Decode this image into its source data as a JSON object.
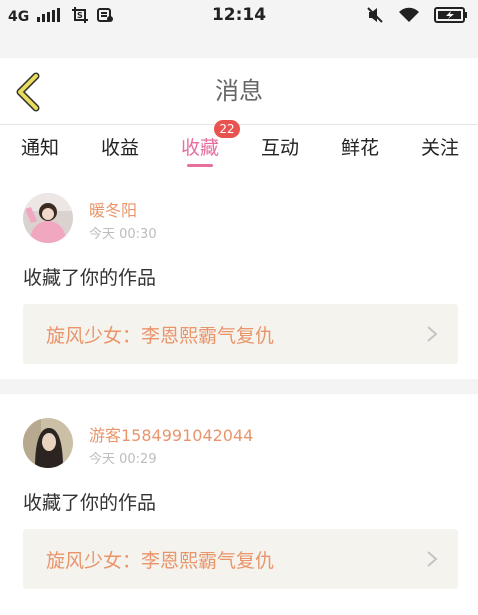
{
  "status_bar": {
    "network": "4G",
    "time": "12:14"
  },
  "header": {
    "title": "消息"
  },
  "tabs": [
    {
      "label": "通知"
    },
    {
      "label": "收益"
    },
    {
      "label": "收藏",
      "active": true,
      "badge": "22"
    },
    {
      "label": "互动"
    },
    {
      "label": "鲜花"
    },
    {
      "label": "关注"
    }
  ],
  "messages": [
    {
      "username": "暖冬阳",
      "time": "今天 00:30",
      "action": "收藏了你的作品",
      "work_title": "旋风少女：李恩熙霸气复仇"
    },
    {
      "username": "游客1584991042044",
      "time": "今天 00:29",
      "action": "收藏了你的作品",
      "work_title": "旋风少女：李恩熙霸气复仇"
    }
  ],
  "colors": {
    "accent_pink": "#e76e9f",
    "username_orange": "#e9956b",
    "badge_red": "#e8524f",
    "back_arrow_yellow": "#e9dd5b"
  }
}
